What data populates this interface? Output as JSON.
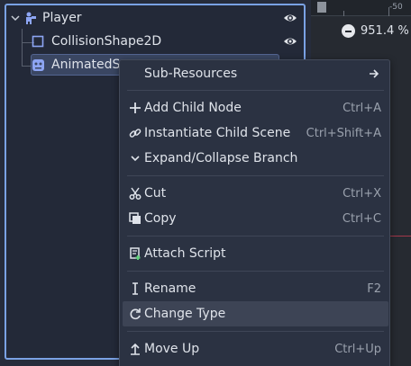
{
  "tree": {
    "player_label": "Player",
    "collision_label": "CollisionShape2D",
    "animated_label": "AnimatedSp"
  },
  "viewport": {
    "ruler_label": "-50",
    "zoom_text": "951.4 %"
  },
  "menu": {
    "sub_resources": "Sub-Resources",
    "add_child_node": "Add Child Node",
    "add_child_node_sc": "Ctrl+A",
    "instantiate": "Instantiate Child Scene",
    "instantiate_sc": "Ctrl+Shift+A",
    "expand_collapse": "Expand/Collapse Branch",
    "cut": "Cut",
    "cut_sc": "Ctrl+X",
    "copy": "Copy",
    "copy_sc": "Ctrl+C",
    "attach_script": "Attach Script",
    "rename": "Rename",
    "rename_sc": "F2",
    "change_type": "Change Type",
    "move_up": "Move Up",
    "move_up_sc": "Ctrl+Up"
  },
  "colors": {
    "accent": "#7aa2e4",
    "menu_bg": "#2b3242",
    "hover": "#3d4455"
  }
}
